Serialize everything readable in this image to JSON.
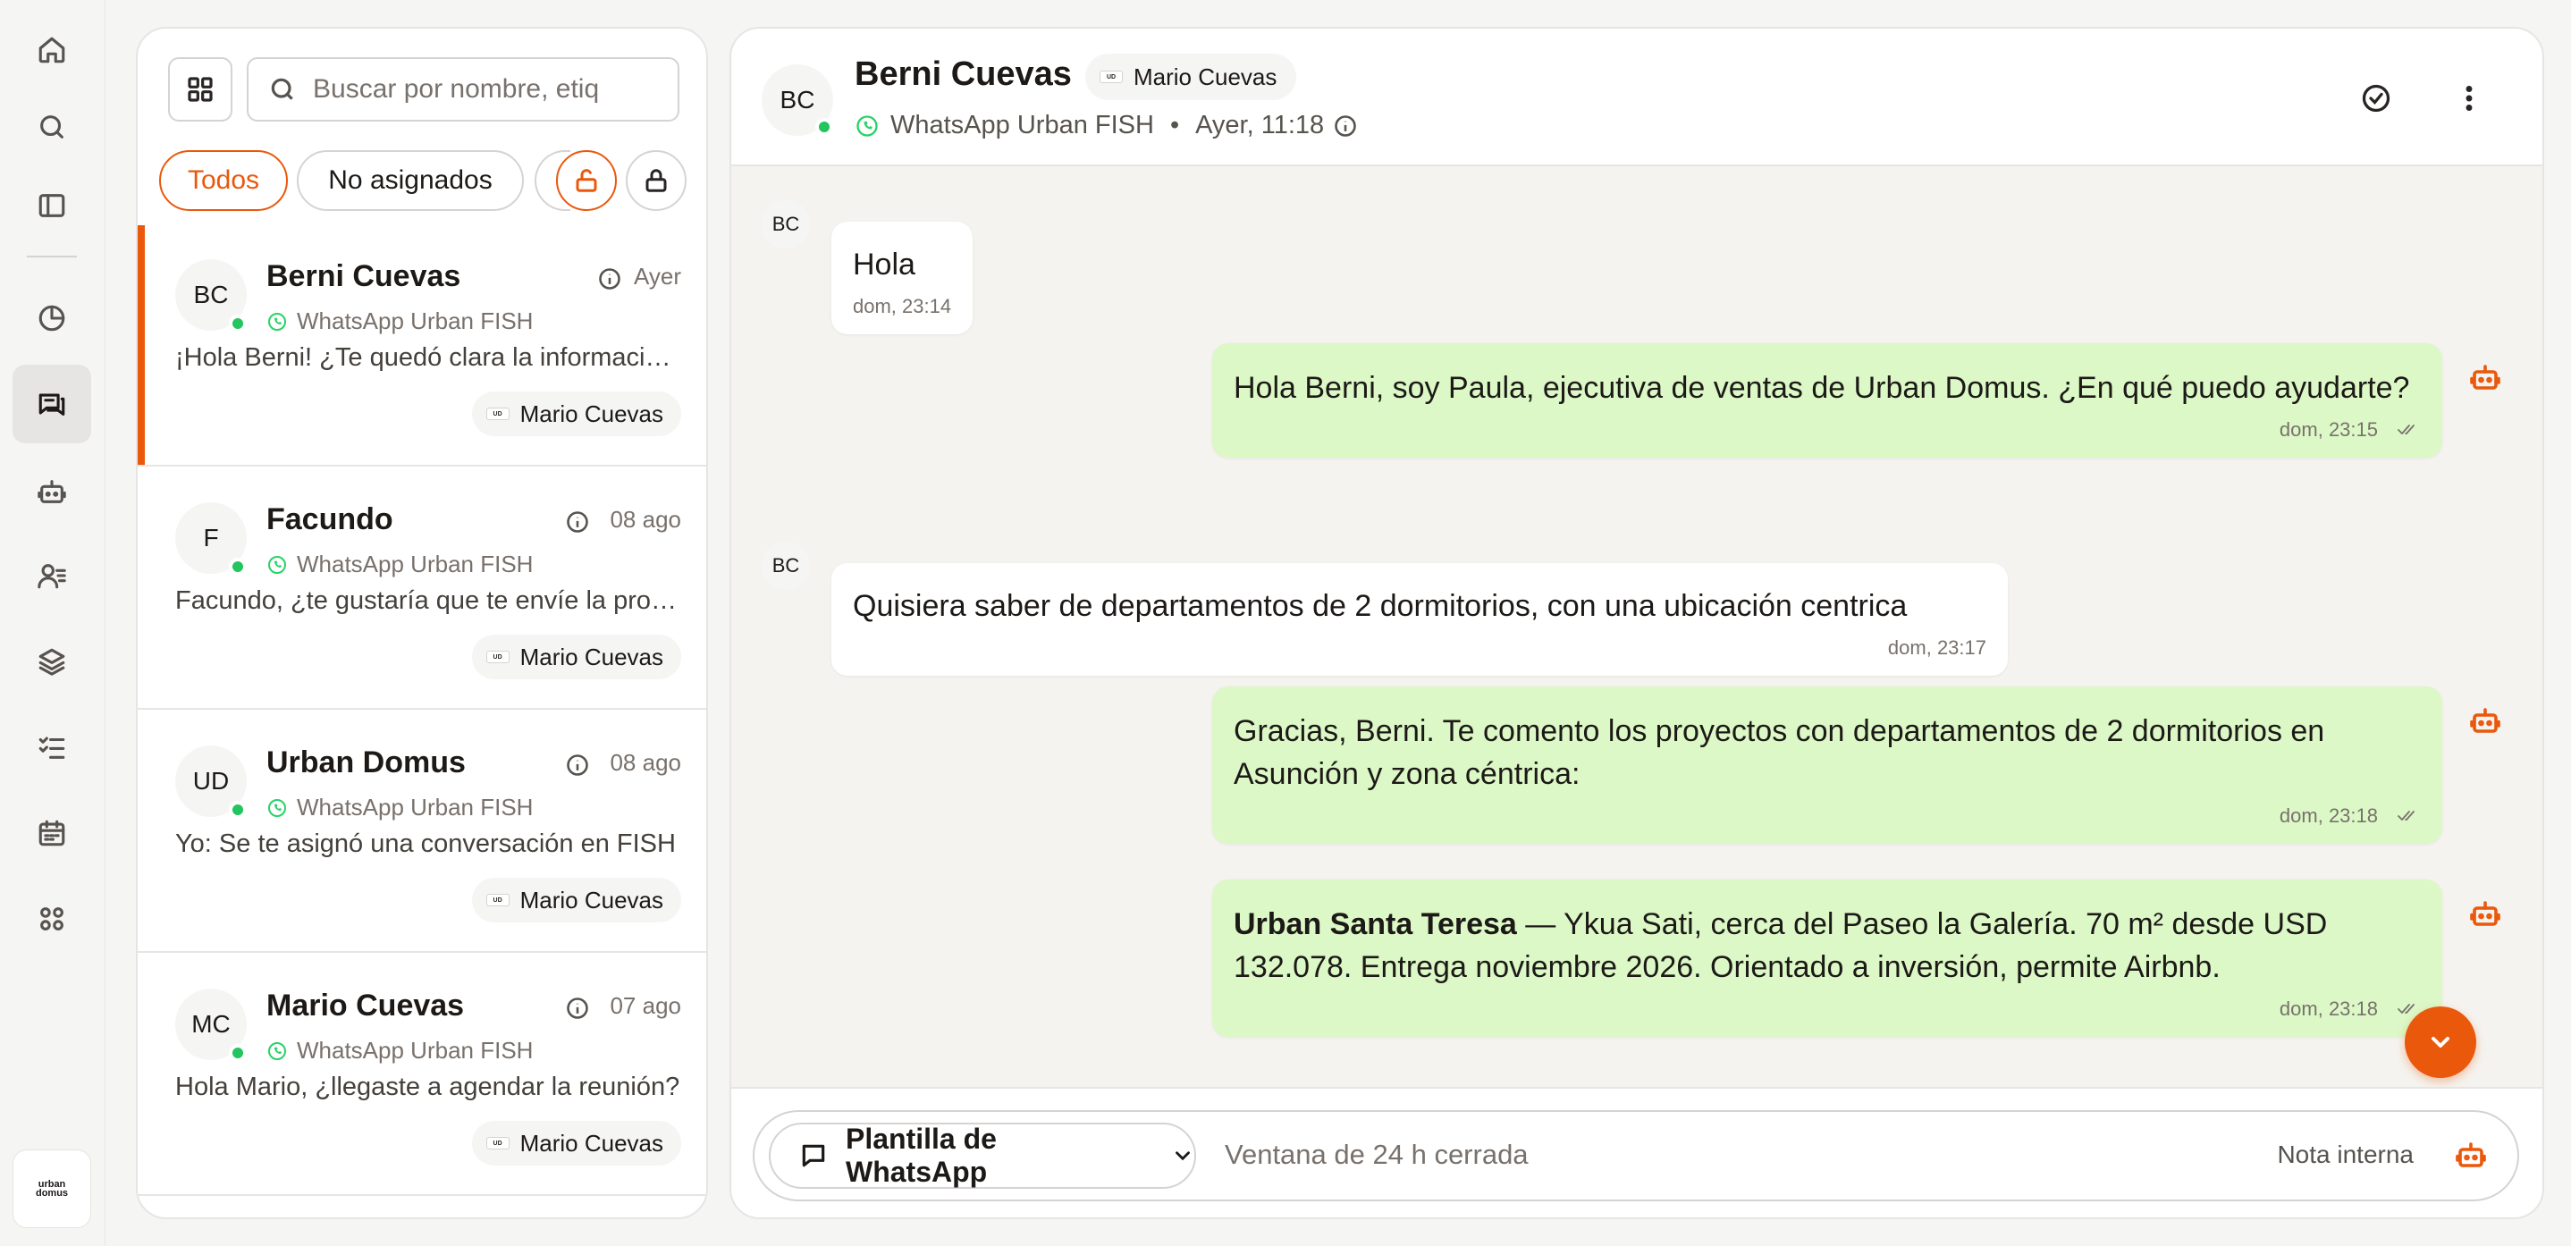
{
  "rail": {
    "items": [
      {
        "icon": "home-icon"
      },
      {
        "icon": "search-icon"
      },
      {
        "icon": "sidebar-toggle-icon"
      },
      {
        "icon": "pie-chart-icon"
      },
      {
        "icon": "chat-icon",
        "active": true
      },
      {
        "icon": "bot-icon"
      },
      {
        "icon": "contacts-icon"
      },
      {
        "icon": "layers-icon"
      },
      {
        "icon": "tasks-icon"
      },
      {
        "icon": "calendar-icon"
      },
      {
        "icon": "apps-icon"
      }
    ],
    "logo_text": "urban domus"
  },
  "list": {
    "search_placeholder": "Buscar por nombre, etiq",
    "filters": {
      "all": "Todos",
      "unassigned": "No asignados"
    },
    "conversations": [
      {
        "initials": "BC",
        "name": "Berni Cuevas",
        "time": "Ayer",
        "channel": "WhatsApp Urban FISH",
        "preview": "¡Hola Berni! ¿Te quedó clara la información?",
        "assignee": "Mario Cuevas",
        "selected": true
      },
      {
        "initials": "F",
        "name": "Facundo",
        "time": "08 ago",
        "channel": "WhatsApp Urban FISH",
        "preview": "Facundo, ¿te gustaría que te envíe la propuesta?",
        "assignee": "Mario Cuevas"
      },
      {
        "initials": "UD",
        "name": "Urban Domus",
        "time": "08 ago",
        "channel": "WhatsApp Urban FISH",
        "preview": "Yo: Se te asignó una conversación en FISH",
        "assignee": "Mario Cuevas"
      },
      {
        "initials": "MC",
        "name": "Mario Cuevas",
        "time": "07 ago",
        "channel": "WhatsApp Urban FISH",
        "preview": "Hola Mario, ¿llegaste a agendar la reunión?",
        "assignee": "Mario Cuevas"
      }
    ]
  },
  "chat": {
    "contact_initials": "BC",
    "contact_name": "Berni Cuevas",
    "assignee": "Mario Cuevas",
    "channel": "WhatsApp Urban FISH",
    "separator": "•",
    "last_seen": "Ayer, 11:18",
    "messages": [
      {
        "direction": "in",
        "initials": "BC",
        "text": "Hola",
        "time": "dom, 23:14"
      },
      {
        "direction": "out",
        "text": "Hola Berni, soy Paula, ejecutiva de ventas de Urban Domus. ¿En qué puedo ayudarte?",
        "time": "dom, 23:15"
      },
      {
        "direction": "in",
        "initials": "BC",
        "text": "Quisiera saber de departamentos de 2 dormitorios, con una ubicación centrica",
        "time": "dom, 23:17"
      },
      {
        "direction": "out",
        "text": "Gracias, Berni. Te comento los proyectos con departamentos de 2 dormitorios en Asunción y zona céntrica:",
        "time": "dom, 23:18"
      },
      {
        "direction": "out",
        "bold": "Urban Santa Teresa",
        "text": " — Ykua Sati, cerca del Paseo la Galería. 70 m² desde USD 132.078. Entrega noviembre 2026. Orientado a inversión, permite Airbnb.",
        "time": "dom, 23:18"
      }
    ],
    "composer": {
      "template_label": "Plantilla de WhatsApp",
      "window_status": "Ventana de 24 h cerrada",
      "note_label": "Nota interna"
    }
  },
  "colors": {
    "accent": "#ea580c",
    "outgoing_bubble": "#dcf8c6",
    "online": "#22c55e",
    "whatsapp": "#25d366"
  }
}
